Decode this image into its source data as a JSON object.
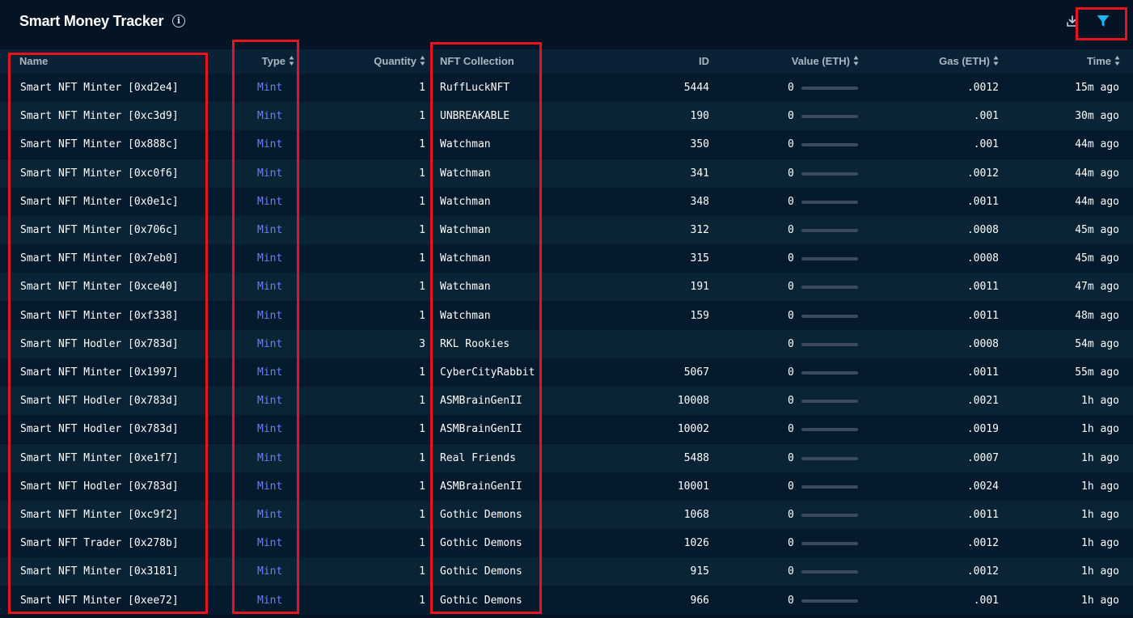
{
  "header": {
    "title": "Smart Money Tracker",
    "info_glyph": "i",
    "icons": [
      "info-icon",
      "download-icon",
      "filter-icon"
    ],
    "accent_color": "#1ab7f0"
  },
  "columns": {
    "name": "Name",
    "type": "Type",
    "quantity": "Quantity",
    "collection": "NFT Collection",
    "id": "ID",
    "value": "Value (ETH)",
    "gas": "Gas (ETH)",
    "time": "Time"
  },
  "rows": [
    {
      "name": "Smart NFT Minter [0xd2e4]",
      "type": "Mint",
      "quantity": "1",
      "collection": "RuffLuckNFT",
      "id": "5444",
      "value": "0",
      "gas": ".0012",
      "time": "15m ago"
    },
    {
      "name": "Smart NFT Minter [0xc3d9]",
      "type": "Mint",
      "quantity": "1",
      "collection": "UNBREAKABLE",
      "id": "190",
      "value": "0",
      "gas": ".001",
      "time": "30m ago"
    },
    {
      "name": "Smart NFT Minter [0x888c]",
      "type": "Mint",
      "quantity": "1",
      "collection": "Watchman",
      "id": "350",
      "value": "0",
      "gas": ".001",
      "time": "44m ago"
    },
    {
      "name": "Smart NFT Minter [0xc0f6]",
      "type": "Mint",
      "quantity": "1",
      "collection": "Watchman",
      "id": "341",
      "value": "0",
      "gas": ".0012",
      "time": "44m ago"
    },
    {
      "name": "Smart NFT Minter [0x0e1c]",
      "type": "Mint",
      "quantity": "1",
      "collection": "Watchman",
      "id": "348",
      "value": "0",
      "gas": ".0011",
      "time": "44m ago"
    },
    {
      "name": "Smart NFT Minter [0x706c]",
      "type": "Mint",
      "quantity": "1",
      "collection": "Watchman",
      "id": "312",
      "value": "0",
      "gas": ".0008",
      "time": "45m ago"
    },
    {
      "name": "Smart NFT Minter [0x7eb0]",
      "type": "Mint",
      "quantity": "1",
      "collection": "Watchman",
      "id": "315",
      "value": "0",
      "gas": ".0008",
      "time": "45m ago"
    },
    {
      "name": "Smart NFT Minter [0xce40]",
      "type": "Mint",
      "quantity": "1",
      "collection": "Watchman",
      "id": "191",
      "value": "0",
      "gas": ".0011",
      "time": "47m ago"
    },
    {
      "name": "Smart NFT Minter [0xf338]",
      "type": "Mint",
      "quantity": "1",
      "collection": "Watchman",
      "id": "159",
      "value": "0",
      "gas": ".0011",
      "time": "48m ago"
    },
    {
      "name": "Smart NFT Hodler [0x783d]",
      "type": "Mint",
      "quantity": "3",
      "collection": "RKL Rookies",
      "id": "",
      "value": "0",
      "gas": ".0008",
      "time": "54m ago"
    },
    {
      "name": "Smart NFT Minter [0x1997]",
      "type": "Mint",
      "quantity": "1",
      "collection": "CyberCityRabbit",
      "id": "5067",
      "value": "0",
      "gas": ".0011",
      "time": "55m ago"
    },
    {
      "name": "Smart NFT Hodler [0x783d]",
      "type": "Mint",
      "quantity": "1",
      "collection": "ASMBrainGenII",
      "id": "10008",
      "value": "0",
      "gas": ".0021",
      "time": "1h ago"
    },
    {
      "name": "Smart NFT Hodler [0x783d]",
      "type": "Mint",
      "quantity": "1",
      "collection": "ASMBrainGenII",
      "id": "10002",
      "value": "0",
      "gas": ".0019",
      "time": "1h ago"
    },
    {
      "name": "Smart NFT Minter [0xe1f7]",
      "type": "Mint",
      "quantity": "1",
      "collection": "Real Friends",
      "id": "5488",
      "value": "0",
      "gas": ".0007",
      "time": "1h ago"
    },
    {
      "name": "Smart NFT Hodler [0x783d]",
      "type": "Mint",
      "quantity": "1",
      "collection": "ASMBrainGenII",
      "id": "10001",
      "value": "0",
      "gas": ".0024",
      "time": "1h ago"
    },
    {
      "name": "Smart NFT Minter [0xc9f2]",
      "type": "Mint",
      "quantity": "1",
      "collection": "Gothic Demons",
      "id": "1068",
      "value": "0",
      "gas": ".0011",
      "time": "1h ago"
    },
    {
      "name": "Smart NFT Trader [0x278b]",
      "type": "Mint",
      "quantity": "1",
      "collection": "Gothic Demons",
      "id": "1026",
      "value": "0",
      "gas": ".0012",
      "time": "1h ago"
    },
    {
      "name": "Smart NFT Minter [0x3181]",
      "type": "Mint",
      "quantity": "1",
      "collection": "Gothic Demons",
      "id": "915",
      "value": "0",
      "gas": ".0012",
      "time": "1h ago"
    },
    {
      "name": "Smart NFT Minter [0xee72]",
      "type": "Mint",
      "quantity": "1",
      "collection": "Gothic Demons",
      "id": "966",
      "value": "0",
      "gas": ".001",
      "time": "1h ago"
    }
  ],
  "highlight_color": "#e8141d"
}
